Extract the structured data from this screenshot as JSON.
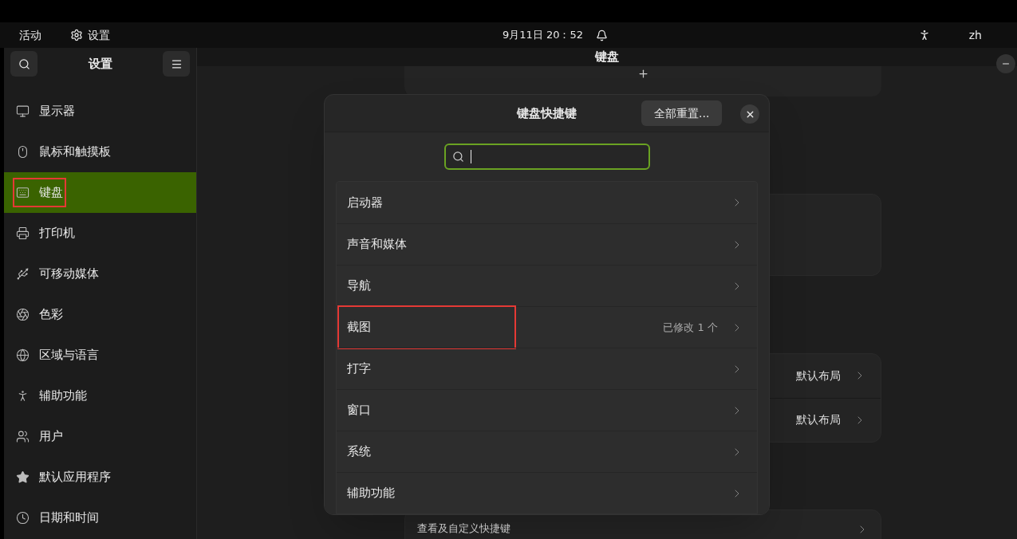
{
  "top_bar": {
    "activities": "活动",
    "app_name": "设置",
    "clock": "9月11日 20：52",
    "language": "zh"
  },
  "sidebar": {
    "title": "设置",
    "items": [
      {
        "label": "显示器",
        "selected": false,
        "highlighted": false
      },
      {
        "label": "鼠标和触摸板",
        "selected": false,
        "highlighted": false
      },
      {
        "label": "键盘",
        "selected": true,
        "highlighted": true
      },
      {
        "label": "打印机",
        "selected": false,
        "highlighted": false
      },
      {
        "label": "可移动媒体",
        "selected": false,
        "highlighted": false
      },
      {
        "label": "色彩",
        "selected": false,
        "highlighted": false
      },
      {
        "label": "区域与语言",
        "selected": false,
        "highlighted": false
      },
      {
        "label": "辅助功能",
        "selected": false,
        "highlighted": false
      },
      {
        "label": "用户",
        "selected": false,
        "highlighted": false
      },
      {
        "label": "默认应用程序",
        "selected": false,
        "highlighted": false
      },
      {
        "label": "日期和时间",
        "selected": false,
        "highlighted": false
      }
    ]
  },
  "header": {
    "title": "键盘"
  },
  "background": {
    "layout_rows": [
      {
        "value": "默认布局"
      },
      {
        "value": "默认布局"
      }
    ],
    "shortcuts_row": "查看及自定义快捷键"
  },
  "dialog": {
    "title": "键盘快捷键",
    "reset_button": "全部重置...",
    "categories": [
      {
        "label": "启动器",
        "highlighted": false
      },
      {
        "label": "声音和媒体",
        "highlighted": false
      },
      {
        "label": "导航",
        "highlighted": false
      },
      {
        "label": "截图",
        "status": "已修改 1 个",
        "highlighted": true
      },
      {
        "label": "打字",
        "highlighted": false
      },
      {
        "label": "窗口",
        "highlighted": false
      },
      {
        "label": "系统",
        "highlighted": false
      },
      {
        "label": "辅助功能",
        "highlighted": false
      }
    ]
  }
}
